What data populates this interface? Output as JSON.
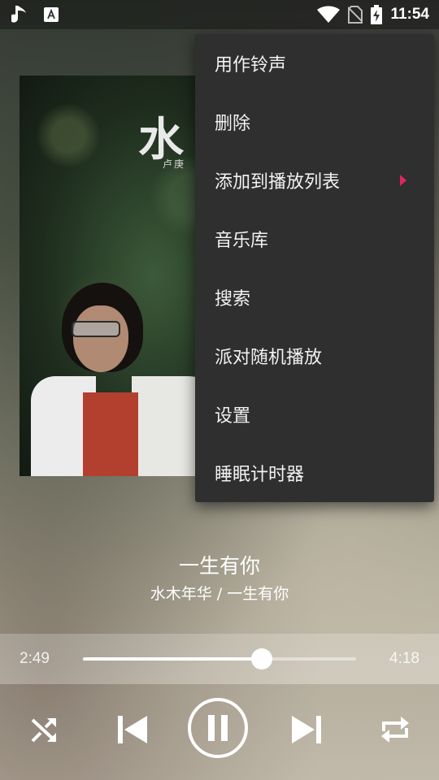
{
  "status_bar": {
    "time": "11:54",
    "icons": [
      "music-note-icon",
      "font-icon",
      "wifi-icon",
      "no-sim-icon",
      "battery-charging-icon"
    ]
  },
  "album_art": {
    "cover_text": "水",
    "cover_subtext": "卢庚"
  },
  "menu": {
    "items": [
      {
        "label": "用作铃声"
      },
      {
        "label": "删除"
      },
      {
        "label": "添加到播放列表",
        "has_submenu": true
      },
      {
        "label": "音乐库"
      },
      {
        "label": "搜索"
      },
      {
        "label": "派对随机播放"
      },
      {
        "label": "设置"
      },
      {
        "label": "睡眠计时器"
      }
    ],
    "submenu_arrow_color": "#e0245e"
  },
  "track": {
    "title": "一生有你",
    "subtitle": "水木年华 / 一生有你"
  },
  "progress": {
    "current": "2:49",
    "total": "4:18",
    "fraction": 0.655
  },
  "controls": {
    "shuffle": "shuffle-icon",
    "previous": "skip-previous-icon",
    "play_pause": "pause-icon",
    "next": "skip-next-icon",
    "repeat": "repeat-icon"
  }
}
